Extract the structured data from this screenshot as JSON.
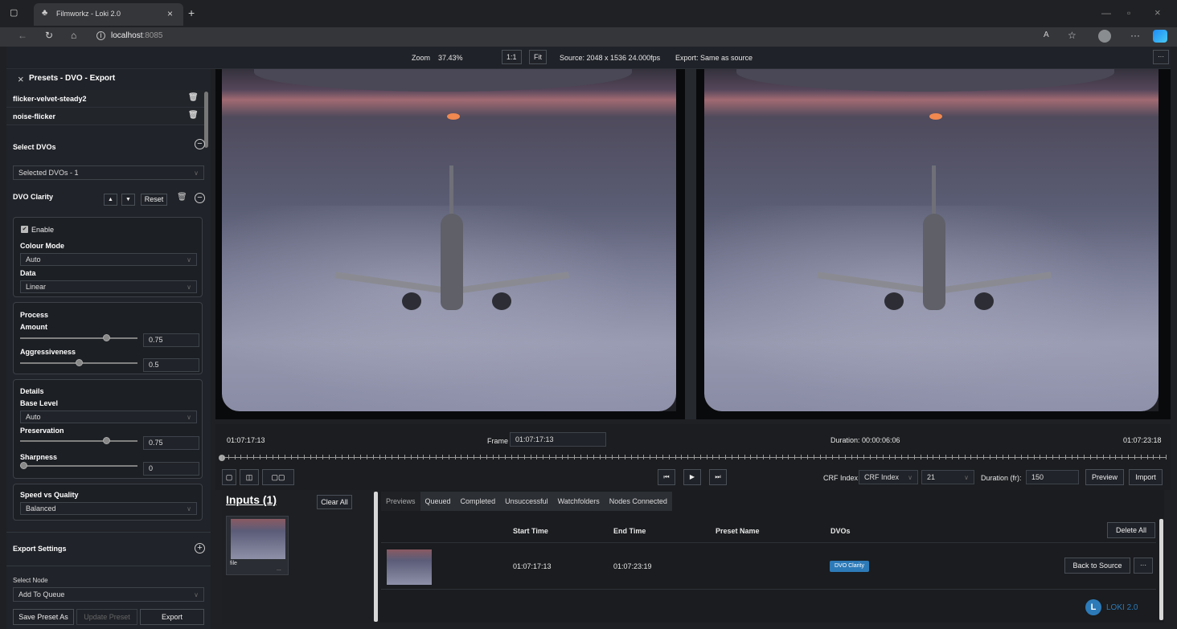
{
  "browser": {
    "tab_title": "Filmworkz - Loki 2.0",
    "url_host": "localhost",
    "url_port": ":8085",
    "colors": {
      "tabbar": "#202124",
      "tab": "#35363a"
    }
  },
  "topbar": {
    "zoom_label": "Zoom",
    "zoom_value": "37.43%",
    "btn_1to1": "1:1",
    "btn_fit": "Fit",
    "source_info": "Source: 2048 x 1536 24.000fps",
    "export_info": "Export: Same as source",
    "menu_btn": "···"
  },
  "left_panel": {
    "header": "Presets - DVO - Export",
    "presets": [
      {
        "name": "flicker-velvet-steady2"
      },
      {
        "name": "noise-flicker"
      }
    ],
    "select_dvos_label": "Select DVOs",
    "selected_dvos_value": "Selected DVOs - 1",
    "dvo_title": "DVO Clarity",
    "reset_label": "Reset",
    "enable_label": "Enable",
    "colour_mode_label": "Colour Mode",
    "colour_mode_value": "Auto",
    "data_label": "Data",
    "data_value": "Linear",
    "process_label": "Process",
    "amount_label": "Amount",
    "amount_value": "0.75",
    "aggressiveness_label": "Aggressiveness",
    "aggressiveness_value": "0.5",
    "details_label": "Details",
    "base_level_label": "Base Level",
    "base_level_value": "Auto",
    "preservation_label": "Preservation",
    "preservation_value": "0.75",
    "sharpness_label": "Sharpness",
    "sharpness_value": "0",
    "speed_quality_label": "Speed vs Quality",
    "speed_quality_value": "Balanced",
    "export_settings_label": "Export Settings",
    "select_node_label": "Select Node",
    "select_node_value": "Add To Queue",
    "save_preset_label": "Save Preset As",
    "update_preset_label": "Update Preset",
    "export_label": "Export"
  },
  "timeline": {
    "start_tc": "01:07:17:13",
    "frame_label": "Frame",
    "frame_value": "01:07:17:13",
    "duration_text": "Duration: 00:00:06:06",
    "end_tc": "01:07:23:18",
    "crf_label": "CRF Index",
    "crf_select": "CRF Index",
    "crf_value": "21",
    "duration_fr_label": "Duration (fr):",
    "duration_fr_value": "150",
    "preview_label": "Preview",
    "import_label": "Import"
  },
  "inputs": {
    "title": "Inputs (1)",
    "clear_all": "Clear All",
    "file_label": "file",
    "file_menu": "..."
  },
  "queue": {
    "tabs": [
      "Previews",
      "Queued",
      "Completed",
      "Unsuccessful",
      "Watchfolders",
      "Nodes Connected"
    ],
    "columns": [
      "Start Time",
      "End Time",
      "Preset Name",
      "DVOs"
    ],
    "delete_all": "Delete All",
    "rows": [
      {
        "start": "01:07:17:13",
        "end": "01:07:23:19",
        "preset": "",
        "dvo": "DVO Clarity"
      }
    ],
    "back_to_source": "Back to Source",
    "row_menu": "···",
    "accent": "#2d7ab8"
  },
  "brand": {
    "text": "LOKI 2.0",
    "mark": "L"
  },
  "sliders": {
    "amount": 0.75,
    "aggressiveness": 0.5,
    "preservation": 0.75,
    "sharpness": 0
  }
}
